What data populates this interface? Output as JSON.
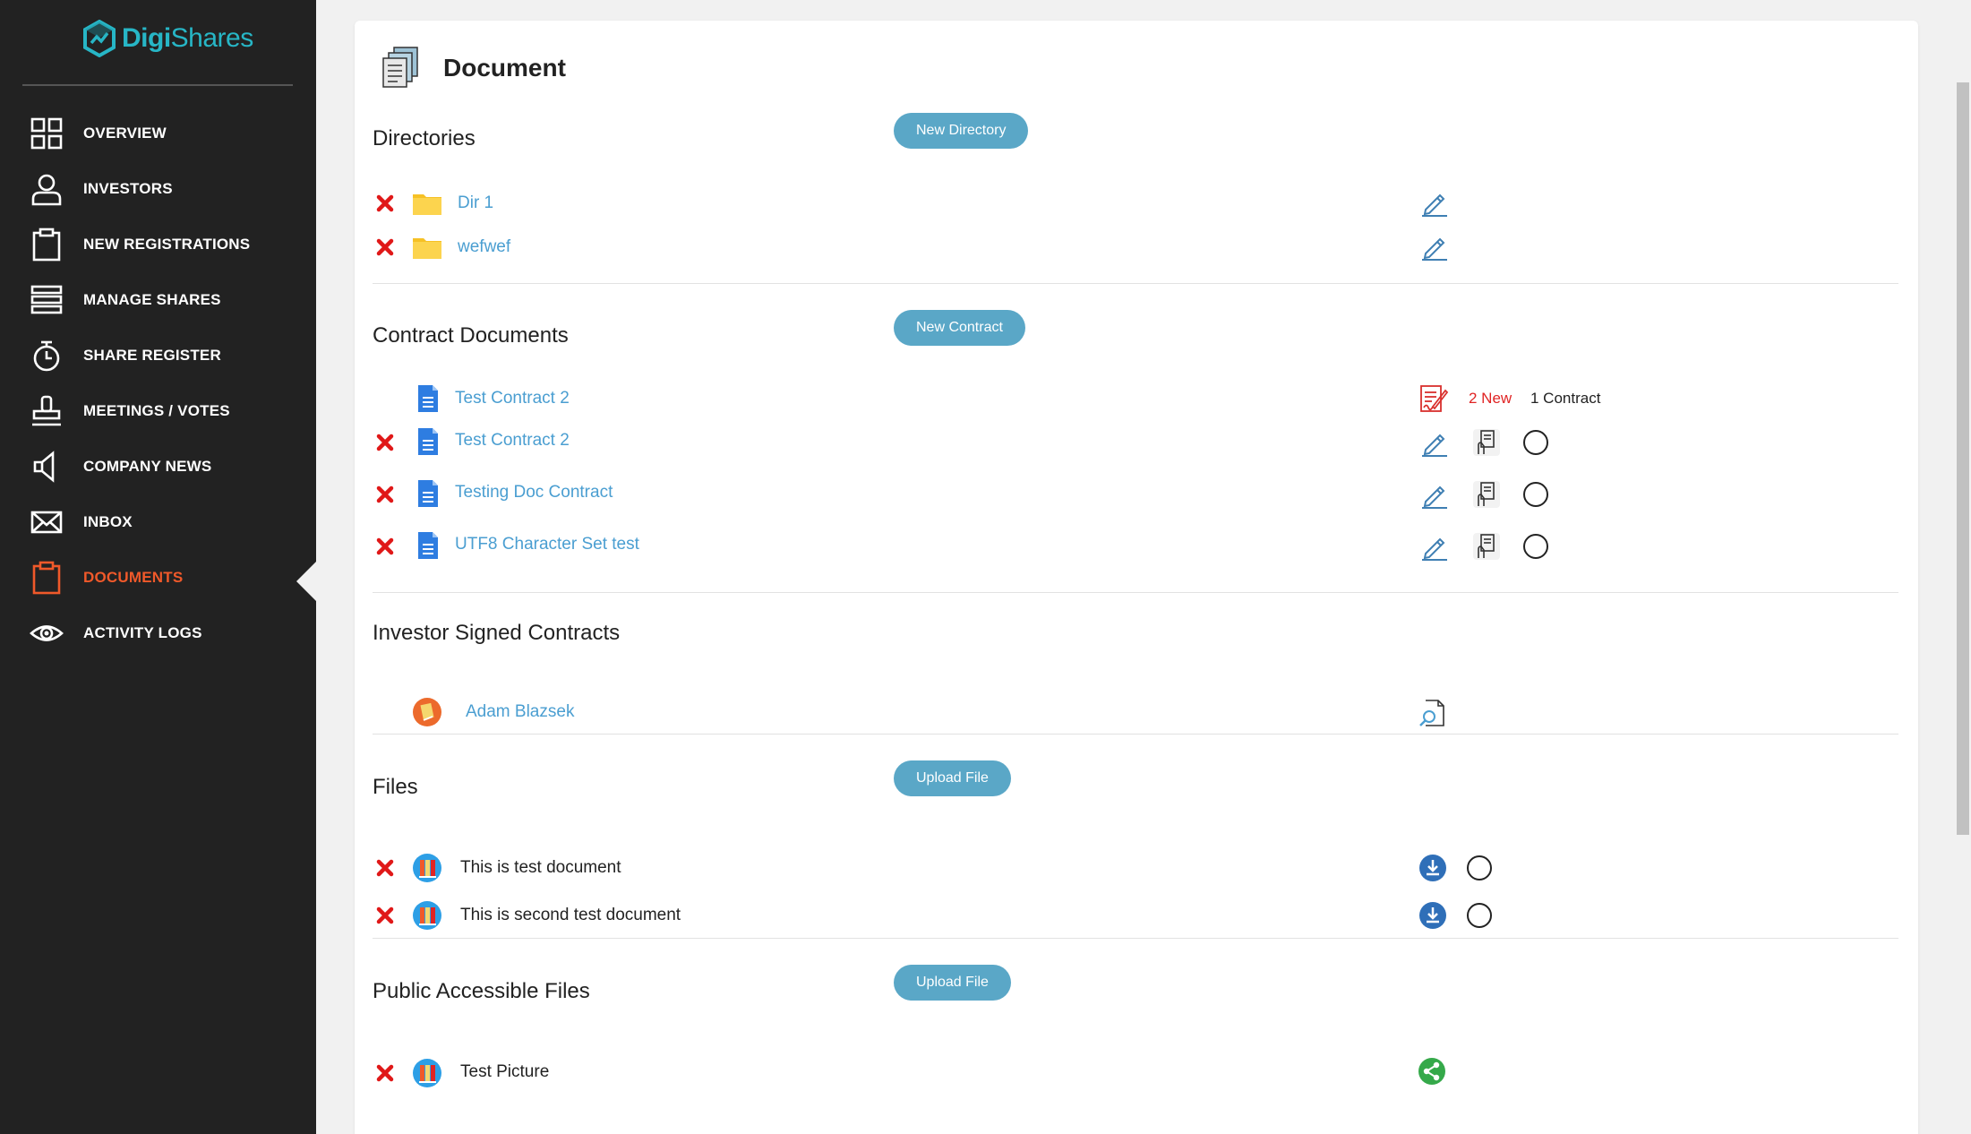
{
  "brand": {
    "name_bold": "Digi",
    "name_regular": "Shares",
    "color": "#27b6c6"
  },
  "sidebar": {
    "items": [
      {
        "label": "OVERVIEW",
        "icon": "grid-icon"
      },
      {
        "label": "INVESTORS",
        "icon": "user-icon"
      },
      {
        "label": "NEW REGISTRATIONS",
        "icon": "clipboard-icon"
      },
      {
        "label": "MANAGE SHARES",
        "icon": "list-icon"
      },
      {
        "label": "SHARE REGISTER",
        "icon": "stopwatch-icon"
      },
      {
        "label": "MEETINGS / VOTES",
        "icon": "stamp-icon"
      },
      {
        "label": "COMPANY NEWS",
        "icon": "megaphone-icon"
      },
      {
        "label": "INBOX",
        "icon": "envelope-icon"
      },
      {
        "label": "DOCUMENTS",
        "icon": "clipboard-icon",
        "active": true
      },
      {
        "label": "ACTIVITY LOGS",
        "icon": "eye-icon"
      }
    ],
    "active_color": "#f0592a"
  },
  "page": {
    "title": "Document"
  },
  "directories": {
    "title": "Directories",
    "button": "New Directory",
    "items": [
      {
        "name": "Dir 1"
      },
      {
        "name": "wefwef"
      }
    ]
  },
  "contracts": {
    "title": "Contract Documents",
    "button": "New Contract",
    "summary": {
      "name": "Test Contract 2",
      "new": "2 New",
      "count": "1 Contract"
    },
    "items": [
      {
        "name": "Test Contract 2"
      },
      {
        "name": "Testing Doc Contract"
      },
      {
        "name": "UTF8 Character Set test"
      }
    ]
  },
  "signed": {
    "title": "Investor Signed Contracts",
    "items": [
      {
        "name": "Adam Blazsek"
      }
    ]
  },
  "files": {
    "title": "Files",
    "button": "Upload File",
    "items": [
      {
        "name": "This is test document"
      },
      {
        "name": "This is second test document"
      }
    ]
  },
  "public_files": {
    "title": "Public Accessible Files",
    "button": "Upload File",
    "items": [
      {
        "name": "Test Picture"
      }
    ]
  },
  "colors": {
    "pill": "#5aa7c7",
    "link": "#4a9ed1",
    "delete": "#e01818",
    "new": "#e02424"
  }
}
